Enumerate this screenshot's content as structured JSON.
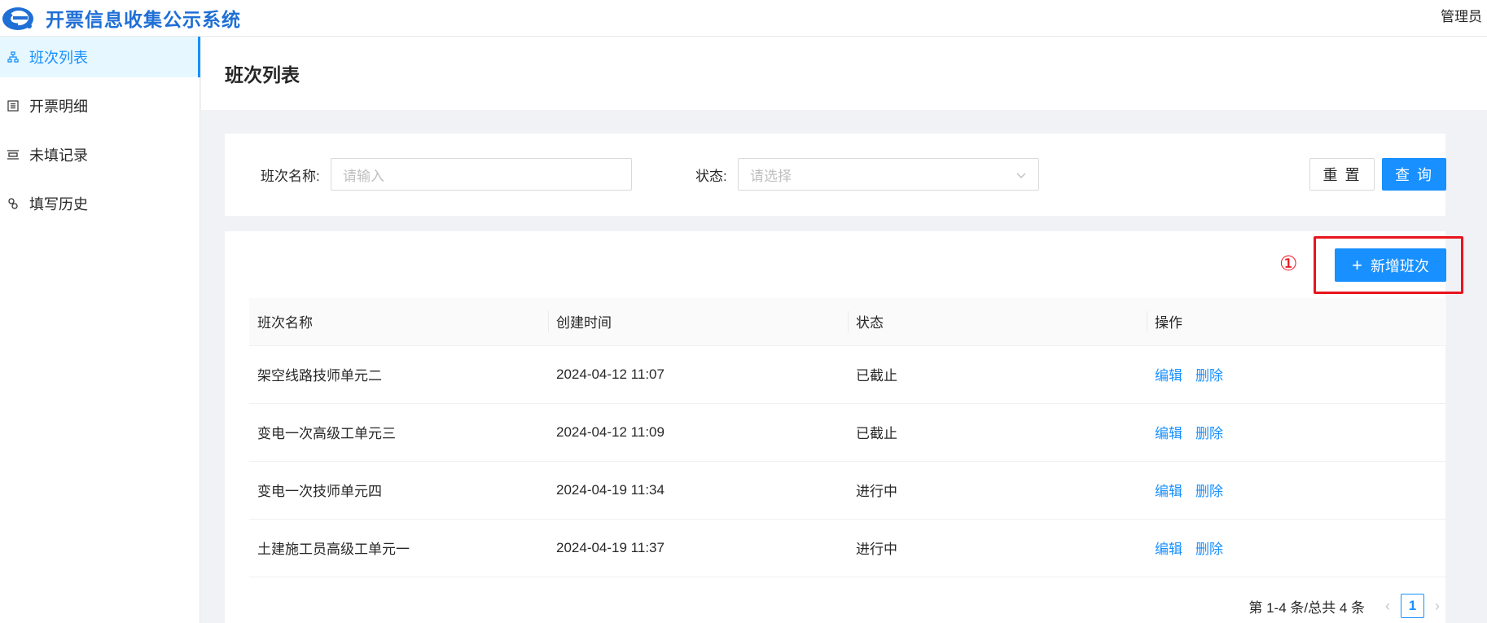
{
  "app": {
    "title": "开票信息收集公示系统",
    "user": "管理员",
    "brand_color": "#1890ff",
    "annotation_color": "#e8141e"
  },
  "sidebar": {
    "items": [
      {
        "label": "班次列表",
        "icon": "sitemap-icon",
        "active": true
      },
      {
        "label": "开票明细",
        "icon": "list-icon",
        "active": false
      },
      {
        "label": "未填记录",
        "icon": "record-icon",
        "active": false
      },
      {
        "label": "填写历史",
        "icon": "history-icon",
        "active": false
      }
    ]
  },
  "page": {
    "title": "班次列表"
  },
  "filter": {
    "name_label": "班次名称:",
    "name_placeholder": "请输入",
    "status_label": "状态:",
    "status_placeholder": "请选择",
    "reset_label": "重 置",
    "search_label": "查 询"
  },
  "toolbar": {
    "annotation": "①",
    "add_label": "新增班次"
  },
  "table": {
    "columns": [
      "班次名称",
      "创建时间",
      "状态",
      "操作"
    ],
    "rows": [
      {
        "name": "架空线路技师单元二",
        "created": "2024-04-12 11:07",
        "status": "已截止"
      },
      {
        "name": "变电一次高级工单元三",
        "created": "2024-04-12 11:09",
        "status": "已截止"
      },
      {
        "name": "变电一次技师单元四",
        "created": "2024-04-19 11:34",
        "status": "进行中"
      },
      {
        "name": "土建施工员高级工单元一",
        "created": "2024-04-19 11:37",
        "status": "进行中"
      }
    ],
    "edit_label": "编辑",
    "delete_label": "删除"
  },
  "pagination": {
    "summary": "第 1-4 条/总共 4 条",
    "current_page": "1"
  }
}
